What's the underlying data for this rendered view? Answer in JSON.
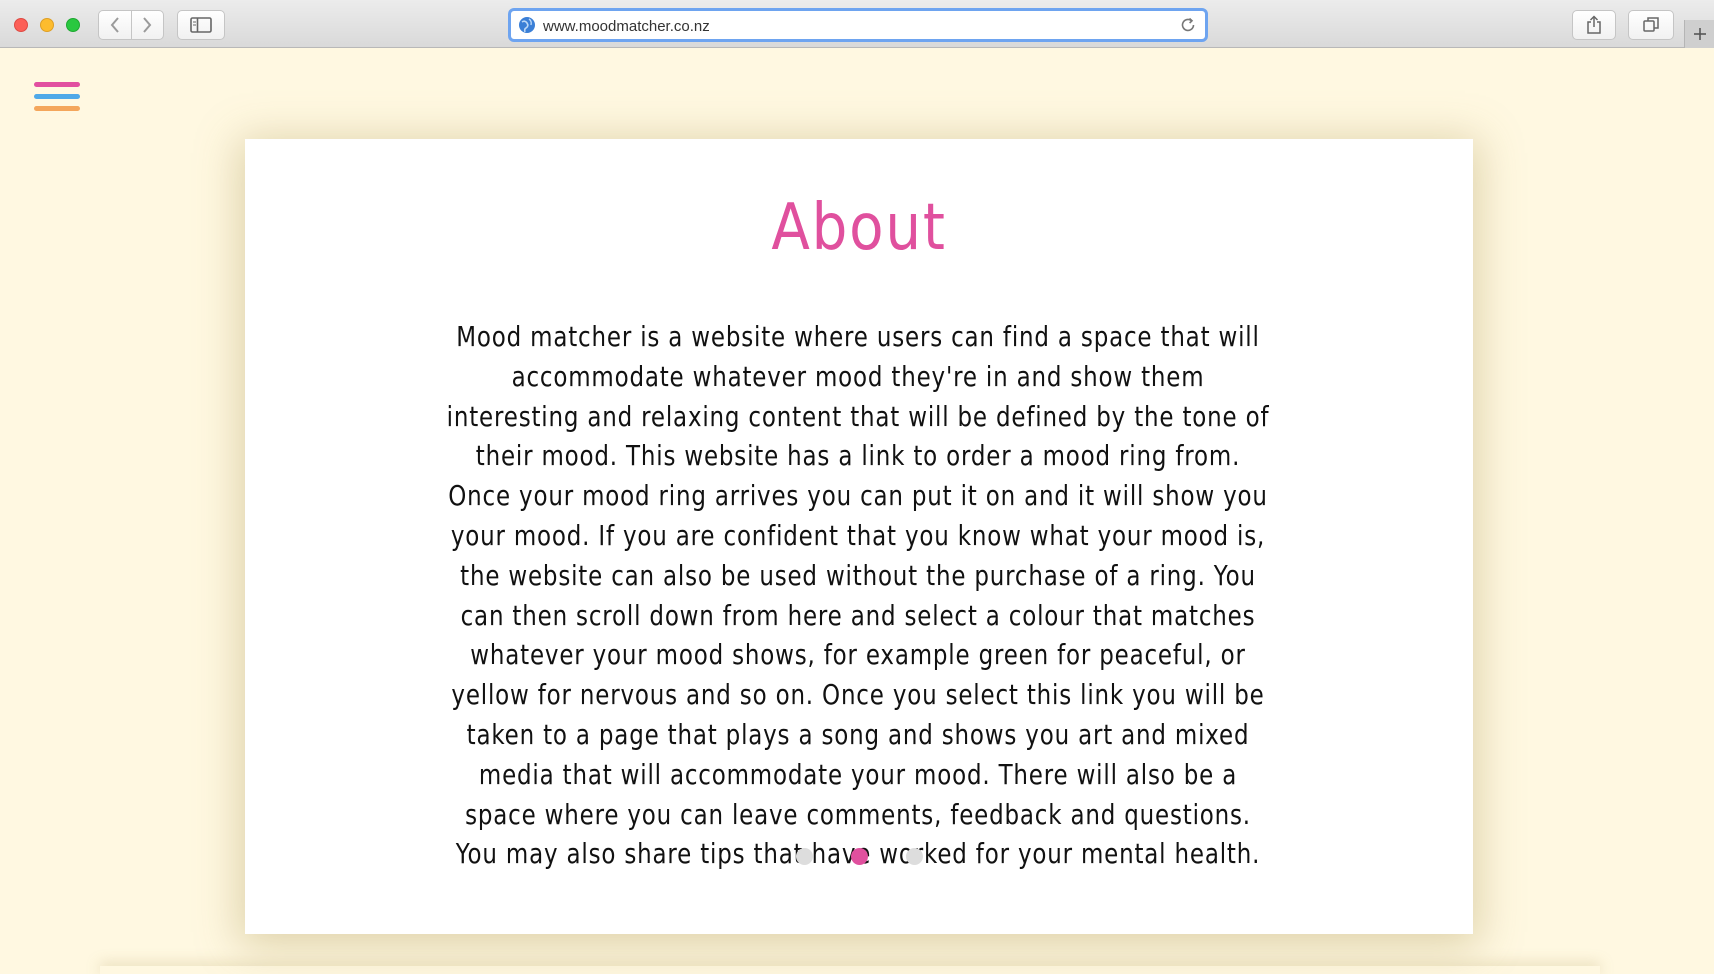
{
  "browser": {
    "url": "www.moodmatcher.co.nz",
    "address_color": "#6ea4f0",
    "icons": {
      "back": "chevron-left-icon",
      "forward": "chevron-right-icon",
      "sidebar": "sidebar-icon",
      "site": "globe-icon",
      "reload": "reload-icon",
      "share": "share-icon",
      "tabs": "tabs-overview-icon",
      "new_tab": "plus-icon"
    }
  },
  "menu": {
    "icon": "hamburger-menu-icon",
    "line_colors": [
      "#e24fa0",
      "#4fa9e8",
      "#f4a65b"
    ]
  },
  "about": {
    "title": "About",
    "body": "Mood matcher is a website where users can find a space that will accommodate whatever mood they're in and show them interesting and relaxing content that will be defined by the tone of their mood. This website has a link to order a mood ring from. Once your mood ring arrives you can put it on and it will show you your mood. If you are confident that you know what your mood is, the website can also be used without the purchase of a ring. You can then scroll down from here and select a colour that matches whatever your mood shows, for example green for peaceful, or yellow for nervous and so on. Once you select this link you will be taken to a page that plays a song and shows you art and mixed media that will accommodate your mood. There will also be a space where you can leave comments, feedback and questions. You may also share tips that have worked for your mental health."
  },
  "carousel": {
    "count": 3,
    "active_index": 1,
    "active_color": "#e0509e",
    "inactive_color": "#dddddd"
  },
  "colors": {
    "page_background": "#fff8e1",
    "card_background": "#ffffff",
    "title": "#e0509e",
    "text": "#111111"
  }
}
